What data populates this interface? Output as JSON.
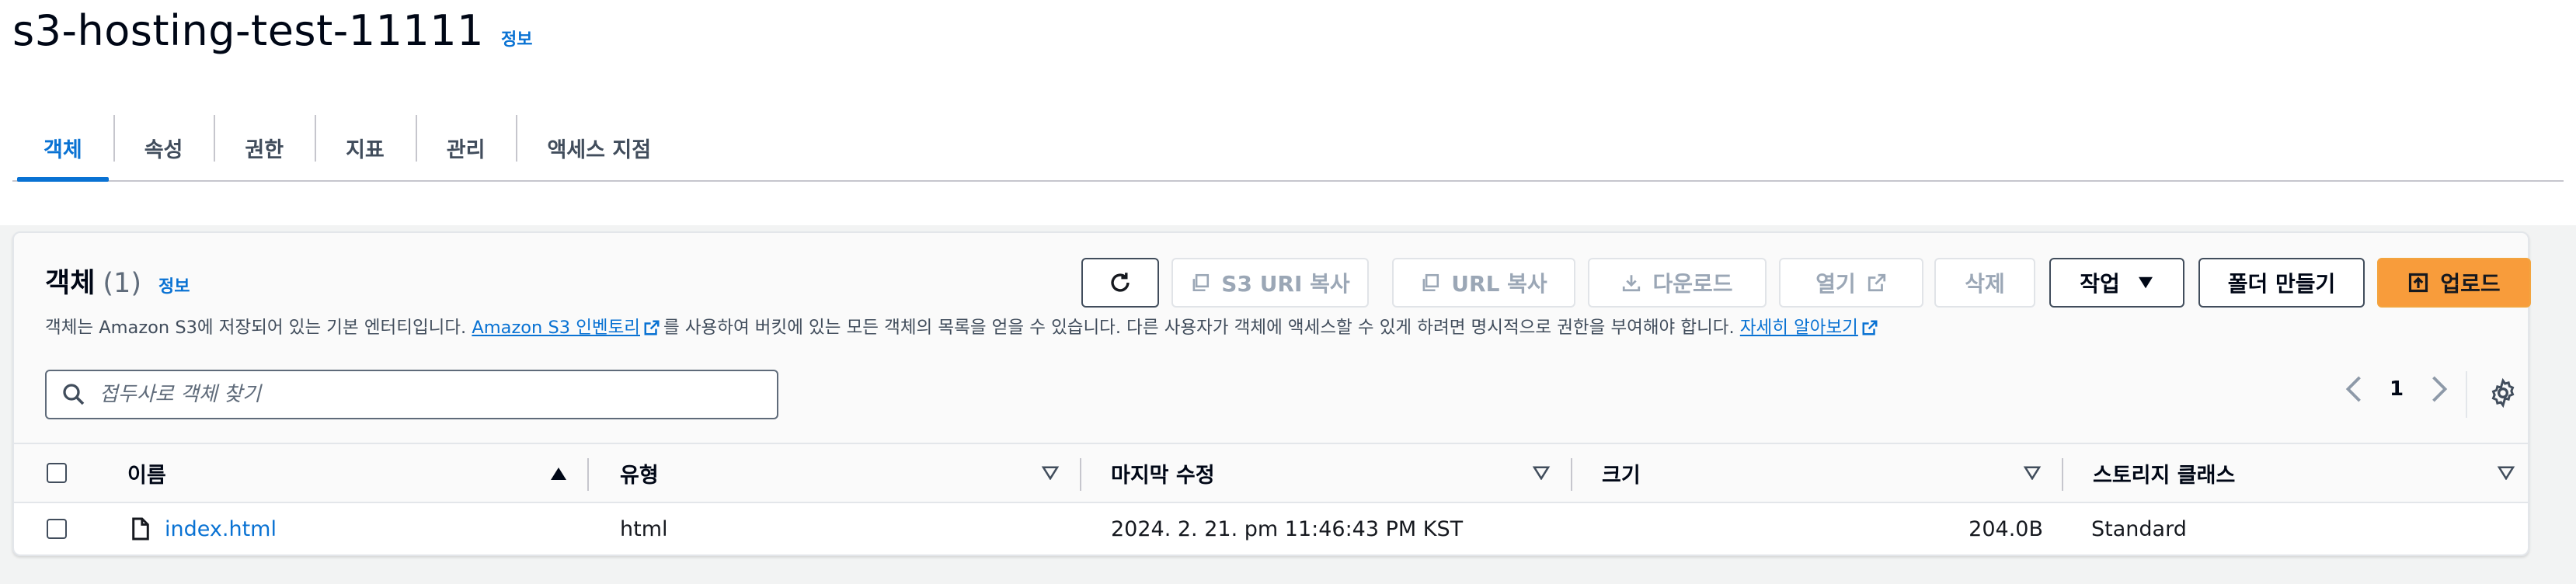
{
  "bucket": {
    "title": "s3-hosting-test-11111",
    "info": "정보"
  },
  "tabs": [
    {
      "label": "객체",
      "active": true
    },
    {
      "label": "속성"
    },
    {
      "label": "권한"
    },
    {
      "label": "지표"
    },
    {
      "label": "관리"
    },
    {
      "label": "액세스 지점"
    }
  ],
  "objects_panel": {
    "title": "객체",
    "count": "(1)",
    "info": "정보",
    "desc_part1": "객체는 Amazon S3에 저장되어 있는 기본 엔터티입니다.",
    "desc_link1": "Amazon S3 인벤토리",
    "desc_part2": "를 사용하여 버킷에 있는 모든 객체의 목록을 얻을 수 있습니다. 다른 사용자가 객체에 액세스할 수 있게 하려면 명시적으로 권한을 부여해야 합니다.",
    "desc_link2": "자세히 알아보기",
    "buttons": {
      "refresh": "refresh-icon",
      "copy_s3_uri": "S3 URI 복사",
      "copy_url": "URL 복사",
      "download": "다운로드",
      "open": "열기",
      "delete": "삭제",
      "actions": "작업",
      "create_folder": "폴더 만들기",
      "upload": "업로드"
    },
    "search_placeholder": "접두사로 객체 찾기",
    "page": "1"
  },
  "table": {
    "columns": [
      "이름",
      "유형",
      "마지막 수정",
      "크기",
      "스토리지 클래스"
    ],
    "rows": [
      {
        "name": "index.html",
        "type": "html",
        "last_modified": "2024. 2. 21. pm 11:46:43 PM KST",
        "size": "204.0B",
        "storage_class": "Standard"
      }
    ]
  },
  "colors": {
    "link": "#0972d3",
    "primary_button": "#f89c3b",
    "disabled_text": "#9ba7b6"
  }
}
